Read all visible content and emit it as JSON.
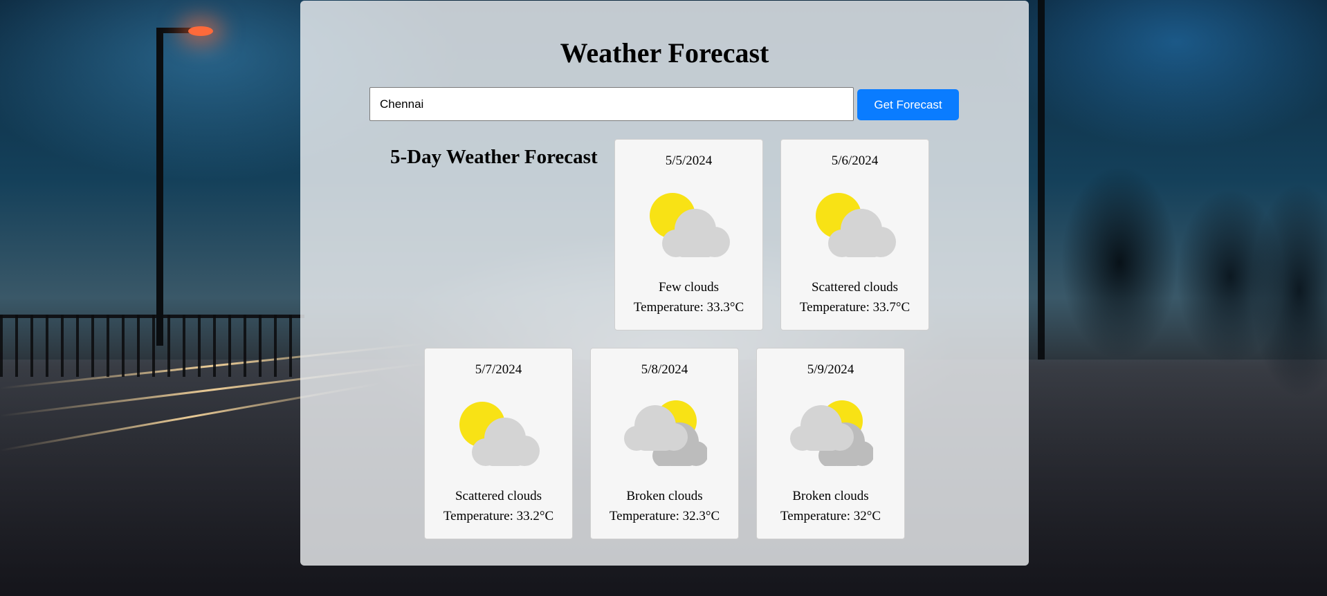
{
  "app": {
    "title": "Weather Forecast"
  },
  "search": {
    "value": "Chennai",
    "button_label": "Get Forecast"
  },
  "forecast": {
    "heading": "5-Day Weather Forecast",
    "days": [
      {
        "date": "5/5/2024",
        "description": "Few clouds",
        "temperature": "Temperature: 33.3°C",
        "icon": "few-clouds-icon"
      },
      {
        "date": "5/6/2024",
        "description": "Scattered clouds",
        "temperature": "Temperature: 33.7°C",
        "icon": "scattered-clouds-icon"
      },
      {
        "date": "5/7/2024",
        "description": "Scattered clouds",
        "temperature": "Temperature: 33.2°C",
        "icon": "scattered-clouds-icon"
      },
      {
        "date": "5/8/2024",
        "description": "Broken clouds",
        "temperature": "Temperature: 32.3°C",
        "icon": "broken-clouds-icon"
      },
      {
        "date": "5/9/2024",
        "description": "Broken clouds",
        "temperature": "Temperature: 32°C",
        "icon": "broken-clouds-icon"
      }
    ]
  },
  "colors": {
    "button_bg": "#0a7cff",
    "sun": "#f8e215",
    "cloud_light": "#d4d4d4",
    "cloud_dark": "#bcbcbc"
  }
}
